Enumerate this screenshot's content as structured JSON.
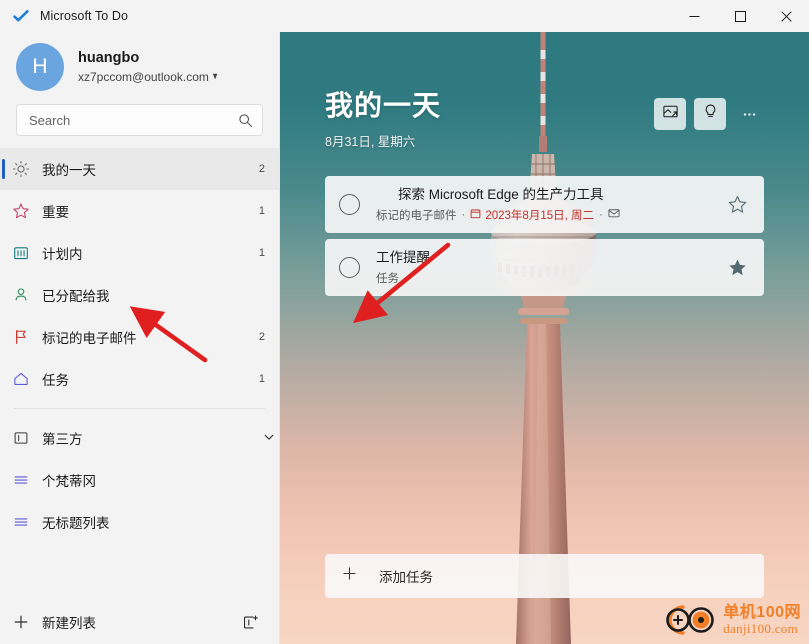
{
  "titlebar": {
    "app_title": "Microsoft To Do",
    "logo_icon": "check-icon",
    "minimize_label": "─",
    "maximize_label": "□",
    "close_label": "✕"
  },
  "sidebar": {
    "account": {
      "avatar_initial": "H",
      "avatar_color": "#6ba5e0",
      "name": "huangbo",
      "email": "xz7pccom@outlook.com",
      "chevron_icon": "chevron-updown-icon"
    },
    "search": {
      "placeholder": "Search",
      "value": "",
      "icon": "search-icon"
    },
    "nav_items": [
      {
        "label": "我的一天",
        "count": "2",
        "icon": "sun-icon",
        "color": "#6b6b6b",
        "selected": true
      },
      {
        "label": "重要",
        "count": "1",
        "icon": "star-icon",
        "color": "#c2426b",
        "selected": false
      },
      {
        "label": "计划内",
        "count": "1",
        "icon": "calendar-icon",
        "color": "#0f7b7b",
        "selected": false
      },
      {
        "label": "已分配给我",
        "count": "",
        "icon": "person-icon",
        "color": "#2f8f5b",
        "selected": false
      },
      {
        "label": "标记的电子邮件",
        "count": "2",
        "icon": "flag-icon",
        "color": "#c4312a",
        "selected": false
      },
      {
        "label": "任务",
        "count": "1",
        "icon": "home-icon",
        "color": "#5b5bd6",
        "selected": false
      }
    ],
    "groups": [
      {
        "label": "第三方",
        "icon": "group-icon",
        "chevron_icon": "chevron-down-icon",
        "type": "group"
      },
      {
        "label": "个梵蒂冈",
        "icon": "list-icon",
        "type": "list"
      },
      {
        "label": "无标题列表",
        "icon": "list-icon",
        "type": "list"
      }
    ],
    "footer": {
      "new_list_label": "新建列表",
      "plus_icon": "plus-icon",
      "new_group_icon": "new-group-icon"
    }
  },
  "main": {
    "header": {
      "title": "我的一天",
      "date": "8月31日, 星期六",
      "actions": [
        {
          "icon": "theme-background-icon",
          "name": "background-theme-button"
        },
        {
          "icon": "lightbulb-icon",
          "name": "suggestions-button"
        },
        {
          "icon": "more-icon",
          "name": "more-options-button",
          "label": "…"
        }
      ]
    },
    "tasks": [
      {
        "title": "探索 Microsoft Edge 的生产力工具",
        "meta_source": "标记的电子邮件",
        "meta_due": "2023年8月15日, 周二",
        "meta_due_color": "#c4312a",
        "due_icon": "calendar-icon",
        "mail_icon": "envelope-icon",
        "separator": "·",
        "starred": false,
        "star_icon": "star-outline-icon",
        "checkbox_icon": "circle-unchecked-icon"
      },
      {
        "title": "工作提醒",
        "meta_source": "任务",
        "meta_due": "",
        "starred": true,
        "star_icon": "star-filled-icon",
        "checkbox_icon": "circle-unchecked-icon"
      }
    ],
    "add_task": {
      "label": "添加任务",
      "plus_icon": "plus-icon"
    },
    "background": {
      "description": "berlin-tv-tower-sunset",
      "top_color": "#2e797f",
      "bottom_color": "#f7d6c3"
    }
  },
  "watermark": {
    "cn_text": "单机100网",
    "en_text": "danji100.com",
    "color": "#f07f28"
  },
  "annotations": {
    "arrow_color": "#e02020",
    "arrows": [
      {
        "name": "arrow-to-assigned-to-me"
      },
      {
        "name": "arrow-to-add-task"
      }
    ]
  }
}
